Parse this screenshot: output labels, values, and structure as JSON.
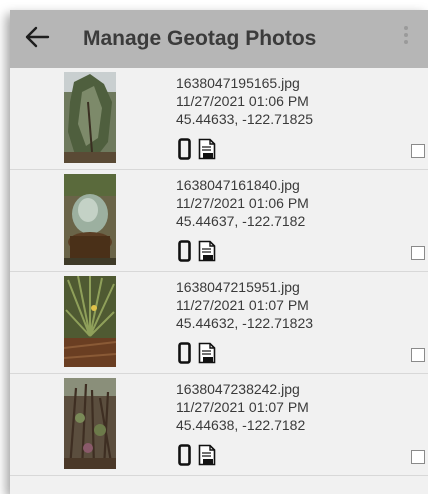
{
  "header": {
    "title": "Manage Geotag Photos",
    "back_icon": "arrow-left-icon",
    "menu_icon": "more-vert-icon"
  },
  "colors": {
    "appbar": "#b6b6b6",
    "background": "#f1f1f1",
    "text": "#3a3a3a"
  },
  "photos": [
    {
      "filename": "1638047195165.jpg",
      "datetime": "11/27/2021 01:06 PM",
      "coords": "45.44633, -122.71825",
      "icons": [
        "phone-icon",
        "jpg-file-icon"
      ],
      "checked": false
    },
    {
      "filename": "1638047161840.jpg",
      "datetime": "11/27/2021 01:06 PM",
      "coords": "45.44637, -122.7182",
      "icons": [
        "phone-icon",
        "jpg-file-icon"
      ],
      "checked": false
    },
    {
      "filename": "1638047215951.jpg",
      "datetime": "11/27/2021 01:07 PM",
      "coords": "45.44632, -122.71823",
      "icons": [
        "phone-icon",
        "jpg-file-icon"
      ],
      "checked": false
    },
    {
      "filename": "1638047238242.jpg",
      "datetime": "11/27/2021 01:07 PM",
      "coords": "45.44638, -122.7182",
      "icons": [
        "phone-icon",
        "jpg-file-icon"
      ],
      "checked": false
    }
  ]
}
